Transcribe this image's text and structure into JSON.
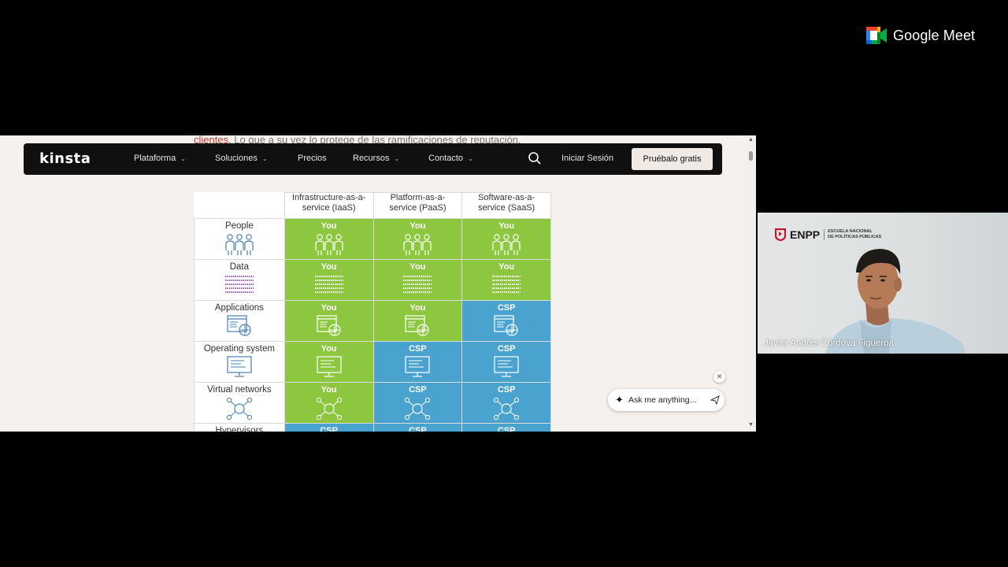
{
  "meet": {
    "brand_name": "Google Meet",
    "logo_icon": "google-meet-icon"
  },
  "page": {
    "above_text_link": "clientes",
    "above_text_rest": ". Lo que a su vez lo protege de las ramificaciones de reputación."
  },
  "kinsta_nav": {
    "logo": "kinsta",
    "items": [
      {
        "label": "Plataforma",
        "has_dropdown": true
      },
      {
        "label": "Soluciones",
        "has_dropdown": true
      },
      {
        "label": "Precios",
        "has_dropdown": false
      },
      {
        "label": "Recursos",
        "has_dropdown": true
      },
      {
        "label": "Contacto",
        "has_dropdown": true
      }
    ],
    "search_icon": "search-icon",
    "login": "Iniciar Sesión",
    "cta": "Pruébalo gratis"
  },
  "table": {
    "headers": [
      "Infrastructure-as-a-service (IaaS)",
      "Platform-as-a-service (PaaS)",
      "Software-as-a-service (SaaS)"
    ],
    "header_lines": [
      [
        "Infrastructure-as-a-",
        "service (IaaS)"
      ],
      [
        "Platform-as-a-",
        "service (PaaS)"
      ],
      [
        "Software-as-a-",
        "service (SaaS)"
      ]
    ],
    "rows": [
      {
        "label": "People",
        "icon": "people-icon",
        "cells": [
          "You",
          "You",
          "You"
        ]
      },
      {
        "label": "Data",
        "icon": "data-icon",
        "cells": [
          "You",
          "You",
          "You"
        ]
      },
      {
        "label": "Applications",
        "icon": "applications-icon",
        "cells": [
          "You",
          "You",
          "CSP"
        ]
      },
      {
        "label": "Operating system",
        "icon": "operating-system-icon",
        "cells": [
          "You",
          "CSP",
          "CSP"
        ]
      },
      {
        "label": "Virtual networks",
        "icon": "virtual-networks-icon",
        "cells": [
          "You",
          "CSP",
          "CSP"
        ]
      },
      {
        "label": "Hypervisors",
        "icon": "hypervisors-icon",
        "cells": [
          "CSP",
          "CSP",
          "CSP"
        ]
      }
    ],
    "colors": {
      "you": "#8dc63f",
      "csp": "#4aa3cf"
    }
  },
  "assistant": {
    "placeholder": "Ask me anything...",
    "spark_icon": "sparkle-icon",
    "send_icon": "send-icon",
    "close_icon": "close-icon"
  },
  "participant": {
    "name": "Javier Andrés Córdova Figueroa",
    "org_acronym": "ENPP",
    "org_full_line1": "ESCUELA NACIONAL",
    "org_full_line2": "DE POLÍTICAS PÚBLICAS"
  }
}
